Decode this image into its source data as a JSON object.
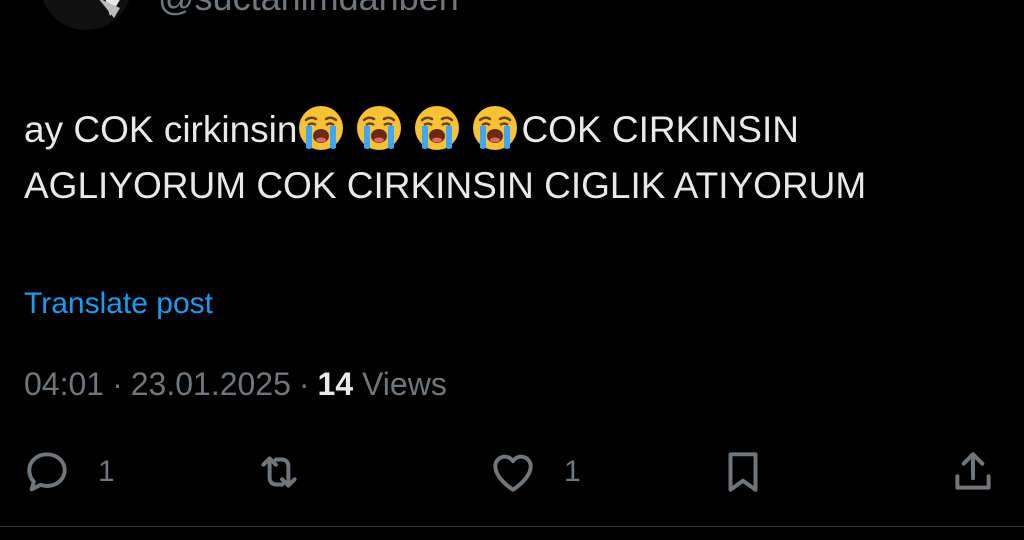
{
  "author": {
    "handle": "@suctanimdanben",
    "avatar": "profile-avatar"
  },
  "post": {
    "line1_text": "ay COK cirkinsin",
    "line1_tail": "COK CIRKINSIN",
    "line2": "AGLIYORUM COK CIRKINSIN CIGLIK ATIYORUM",
    "emoji": "loudly-crying-face"
  },
  "translate_label": "Translate post",
  "meta": {
    "time": "04:01",
    "date": "23.01.2025",
    "separator": "·",
    "views_count": "14",
    "views_label": "Views"
  },
  "actions": {
    "reply_icon": "reply-icon",
    "reply_count": "1",
    "repost_icon": "repost-icon",
    "like_icon": "heart-icon",
    "like_count": "1",
    "bookmark_icon": "bookmark-icon",
    "share_icon": "share-icon"
  },
  "colors": {
    "background": "#000000",
    "text": "#e7e9ea",
    "muted": "#71767b",
    "link": "#1d9bf0"
  }
}
